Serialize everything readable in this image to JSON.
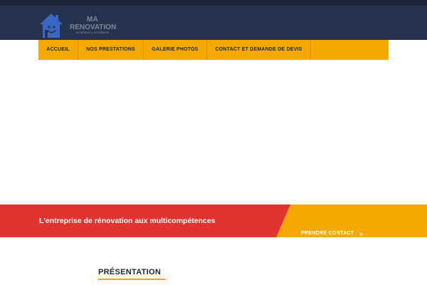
{
  "header": {
    "logo": {
      "line1": "MA",
      "line2": "RENOVATION",
      "tagline": "INTERIEUR & EXTERIEUR",
      "icon": "house-icon"
    }
  },
  "nav": {
    "items": [
      {
        "label": "ACCUEIL"
      },
      {
        "label": "NOS PRESTATIONS"
      },
      {
        "label": "GALERIE PHOTOS"
      },
      {
        "label": "CONTACT ET DEMANDE DE DEVIS"
      }
    ]
  },
  "banner": {
    "text": "L'entreprise de rénovation aux multicompétences",
    "cta_label": "PRENDRE CONTACT",
    "cta_icon": "double-chevron-right-icon"
  },
  "section": {
    "title": "PRÉSENTATION"
  },
  "colors": {
    "header_bg": "#26334f",
    "accent_yellow": "#f5a800",
    "accent_red": "#e1332f",
    "logo_blue": "#3a66c4"
  }
}
